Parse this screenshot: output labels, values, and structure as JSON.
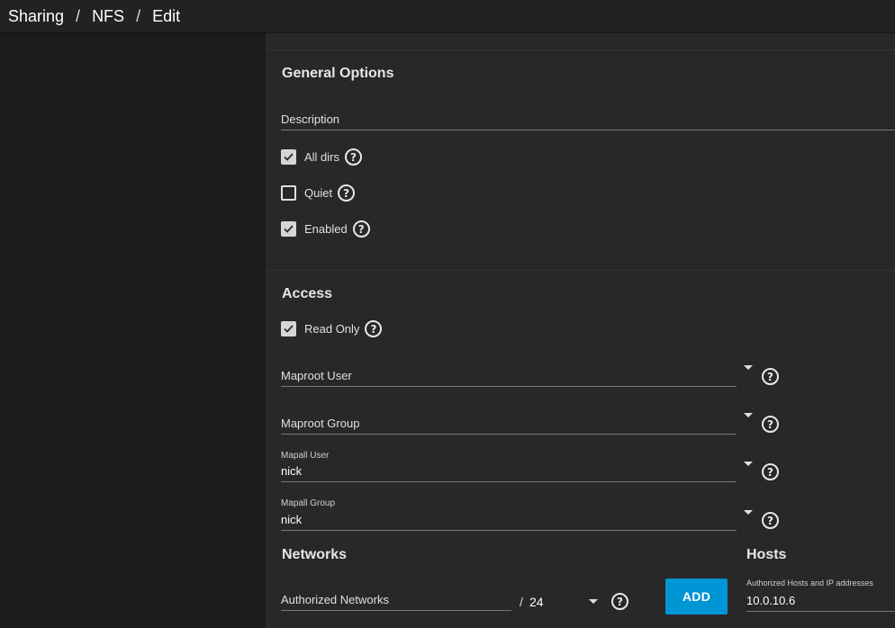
{
  "breadcrumb": [
    "Sharing",
    "NFS",
    "Edit"
  ],
  "general": {
    "title": "General Options",
    "description_label": "Description",
    "checkboxes": [
      {
        "label": "All dirs",
        "checked": true
      },
      {
        "label": "Quiet",
        "checked": false
      },
      {
        "label": "Enabled",
        "checked": true
      }
    ]
  },
  "access": {
    "title": "Access",
    "read_only": {
      "label": "Read Only",
      "checked": true
    },
    "maproot_user": {
      "label": "Maproot User",
      "value": ""
    },
    "maproot_group": {
      "label": "Maproot Group",
      "value": ""
    },
    "mapall_user": {
      "label": "Mapall User",
      "value": "nick"
    },
    "mapall_group": {
      "label": "Mapall Group",
      "value": "nick"
    }
  },
  "networks": {
    "title": "Networks",
    "authorized_label": "Authorized Networks",
    "slash": "/",
    "mask": "24",
    "add_label": "ADD"
  },
  "hosts": {
    "title": "Hosts",
    "label": "Authorized Hosts and IP addresses",
    "value": "10.0.10.6"
  },
  "help_glyph": "?",
  "colors": {
    "accent": "#0095d5",
    "panel": "#282828",
    "background": "#1c1c1c"
  }
}
